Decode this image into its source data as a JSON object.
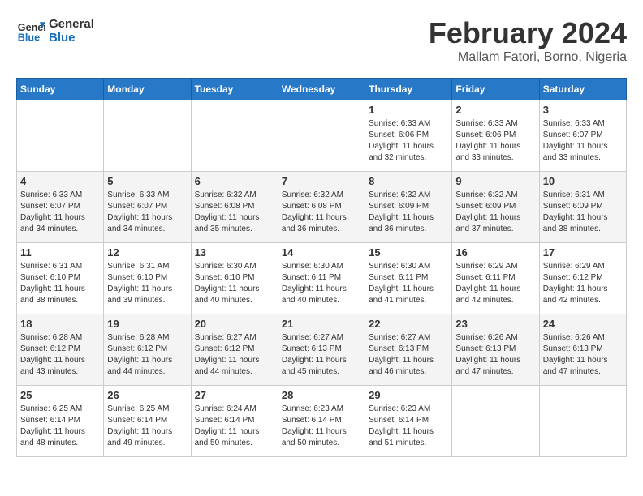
{
  "header": {
    "logo_line1": "General",
    "logo_line2": "Blue",
    "month": "February 2024",
    "location": "Mallam Fatori, Borno, Nigeria"
  },
  "days_of_week": [
    "Sunday",
    "Monday",
    "Tuesday",
    "Wednesday",
    "Thursday",
    "Friday",
    "Saturday"
  ],
  "weeks": [
    [
      {
        "day": "",
        "info": ""
      },
      {
        "day": "",
        "info": ""
      },
      {
        "day": "",
        "info": ""
      },
      {
        "day": "",
        "info": ""
      },
      {
        "day": "1",
        "info": "Sunrise: 6:33 AM\nSunset: 6:06 PM\nDaylight: 11 hours\nand 32 minutes."
      },
      {
        "day": "2",
        "info": "Sunrise: 6:33 AM\nSunset: 6:06 PM\nDaylight: 11 hours\nand 33 minutes."
      },
      {
        "day": "3",
        "info": "Sunrise: 6:33 AM\nSunset: 6:07 PM\nDaylight: 11 hours\nand 33 minutes."
      }
    ],
    [
      {
        "day": "4",
        "info": "Sunrise: 6:33 AM\nSunset: 6:07 PM\nDaylight: 11 hours\nand 34 minutes."
      },
      {
        "day": "5",
        "info": "Sunrise: 6:33 AM\nSunset: 6:07 PM\nDaylight: 11 hours\nand 34 minutes."
      },
      {
        "day": "6",
        "info": "Sunrise: 6:32 AM\nSunset: 6:08 PM\nDaylight: 11 hours\nand 35 minutes."
      },
      {
        "day": "7",
        "info": "Sunrise: 6:32 AM\nSunset: 6:08 PM\nDaylight: 11 hours\nand 36 minutes."
      },
      {
        "day": "8",
        "info": "Sunrise: 6:32 AM\nSunset: 6:09 PM\nDaylight: 11 hours\nand 36 minutes."
      },
      {
        "day": "9",
        "info": "Sunrise: 6:32 AM\nSunset: 6:09 PM\nDaylight: 11 hours\nand 37 minutes."
      },
      {
        "day": "10",
        "info": "Sunrise: 6:31 AM\nSunset: 6:09 PM\nDaylight: 11 hours\nand 38 minutes."
      }
    ],
    [
      {
        "day": "11",
        "info": "Sunrise: 6:31 AM\nSunset: 6:10 PM\nDaylight: 11 hours\nand 38 minutes."
      },
      {
        "day": "12",
        "info": "Sunrise: 6:31 AM\nSunset: 6:10 PM\nDaylight: 11 hours\nand 39 minutes."
      },
      {
        "day": "13",
        "info": "Sunrise: 6:30 AM\nSunset: 6:10 PM\nDaylight: 11 hours\nand 40 minutes."
      },
      {
        "day": "14",
        "info": "Sunrise: 6:30 AM\nSunset: 6:11 PM\nDaylight: 11 hours\nand 40 minutes."
      },
      {
        "day": "15",
        "info": "Sunrise: 6:30 AM\nSunset: 6:11 PM\nDaylight: 11 hours\nand 41 minutes."
      },
      {
        "day": "16",
        "info": "Sunrise: 6:29 AM\nSunset: 6:11 PM\nDaylight: 11 hours\nand 42 minutes."
      },
      {
        "day": "17",
        "info": "Sunrise: 6:29 AM\nSunset: 6:12 PM\nDaylight: 11 hours\nand 42 minutes."
      }
    ],
    [
      {
        "day": "18",
        "info": "Sunrise: 6:28 AM\nSunset: 6:12 PM\nDaylight: 11 hours\nand 43 minutes."
      },
      {
        "day": "19",
        "info": "Sunrise: 6:28 AM\nSunset: 6:12 PM\nDaylight: 11 hours\nand 44 minutes."
      },
      {
        "day": "20",
        "info": "Sunrise: 6:27 AM\nSunset: 6:12 PM\nDaylight: 11 hours\nand 44 minutes."
      },
      {
        "day": "21",
        "info": "Sunrise: 6:27 AM\nSunset: 6:13 PM\nDaylight: 11 hours\nand 45 minutes."
      },
      {
        "day": "22",
        "info": "Sunrise: 6:27 AM\nSunset: 6:13 PM\nDaylight: 11 hours\nand 46 minutes."
      },
      {
        "day": "23",
        "info": "Sunrise: 6:26 AM\nSunset: 6:13 PM\nDaylight: 11 hours\nand 47 minutes."
      },
      {
        "day": "24",
        "info": "Sunrise: 6:26 AM\nSunset: 6:13 PM\nDaylight: 11 hours\nand 47 minutes."
      }
    ],
    [
      {
        "day": "25",
        "info": "Sunrise: 6:25 AM\nSunset: 6:14 PM\nDaylight: 11 hours\nand 48 minutes."
      },
      {
        "day": "26",
        "info": "Sunrise: 6:25 AM\nSunset: 6:14 PM\nDaylight: 11 hours\nand 49 minutes."
      },
      {
        "day": "27",
        "info": "Sunrise: 6:24 AM\nSunset: 6:14 PM\nDaylight: 11 hours\nand 50 minutes."
      },
      {
        "day": "28",
        "info": "Sunrise: 6:23 AM\nSunset: 6:14 PM\nDaylight: 11 hours\nand 50 minutes."
      },
      {
        "day": "29",
        "info": "Sunrise: 6:23 AM\nSunset: 6:14 PM\nDaylight: 11 hours\nand 51 minutes."
      },
      {
        "day": "",
        "info": ""
      },
      {
        "day": "",
        "info": ""
      }
    ]
  ]
}
